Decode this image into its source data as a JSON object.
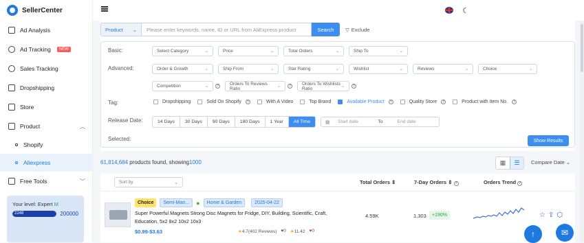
{
  "app": {
    "name": "SellerCenter"
  },
  "sidebar": {
    "items": [
      {
        "label": "Ad Analysis",
        "icon": "chart-icon"
      },
      {
        "label": "Ad Tracking",
        "icon": "target-icon",
        "badge": "NEW"
      },
      {
        "label": "Sales Tracking",
        "icon": "gauge-icon"
      },
      {
        "label": "Dropshipping",
        "icon": "box-icon"
      },
      {
        "label": "Store",
        "icon": "store-icon"
      },
      {
        "label": "Product",
        "icon": "product-icon"
      },
      {
        "label": "Free Tools",
        "icon": "tools-icon"
      }
    ],
    "sub_items": [
      {
        "label": "Shopify"
      },
      {
        "label": "Aliexpress",
        "active": true
      }
    ],
    "level": {
      "label": "Your level: Expert ",
      "tier": "M",
      "current": "2248",
      "max": "200000",
      "progress_fraction": 0.011
    }
  },
  "search": {
    "scope": "Product",
    "placeholder": "Please enter keywords,  name, ID or URL from AliExpress product",
    "button": "Search",
    "exclude": "Exclude"
  },
  "filters": {
    "basic_label": "Basic:",
    "basic": [
      "Select Category",
      "Price",
      "Total Orders",
      "Ship To"
    ],
    "advanced_label": "Advanced:",
    "advanced_row1": [
      "Order & Growth",
      "Ship From",
      "Star Rating",
      "Wishlist",
      "Reviews",
      "Choice"
    ],
    "advanced_row2": [
      "Competition",
      "Orders To Reviews Ratio",
      "Orders To Wishlists Ratio"
    ],
    "tag_label": "Tag:",
    "tags": [
      {
        "label": "Dropshipping",
        "checked": false
      },
      {
        "label": "Sold On Shopify",
        "checked": false,
        "help": true
      },
      {
        "label": "With A Video",
        "checked": false
      },
      {
        "label": "Top Brand",
        "checked": false
      },
      {
        "label": "Available Product",
        "checked": true,
        "help": true
      },
      {
        "label": "Quality Store",
        "checked": false,
        "help": true
      },
      {
        "label": "Product with Item No.",
        "checked": false,
        "help": true
      }
    ],
    "release_label": "Release Date:",
    "release_options": [
      "14 Days",
      "30 Days",
      "90 Days",
      "180 Days",
      "1 Year",
      "All Time"
    ],
    "release_selected": "All Time",
    "start_placeholder": "Start date",
    "to": "To",
    "end_placeholder": "End date",
    "selected_label": "Selected:",
    "show_results": "Show Results"
  },
  "results": {
    "count": "61,814,684",
    "text": " products found, showing",
    "showing": "1000",
    "compare": "Compare Date"
  },
  "table": {
    "sort_placeholder": "Sort by",
    "headers": {
      "total_orders": "Total Orders",
      "seven_day": "7-Day Orders",
      "trend": "Orders Trend"
    },
    "rows": [
      {
        "tags": [
          "Choice",
          "Semi-Man...",
          "Home & Garden",
          "2025-04-22"
        ],
        "title": "Super Powerful Magnets Strong Disc Magnets for Fridge, DIY, Building, Scientific, Craft, Education, 5x2 8x2 10x2 10x3",
        "price": "$0.99-$3.63",
        "rating": "4.7(402 Reviews)",
        "hearts": "0",
        "store_rating": "11.42",
        "likes": "0",
        "total_orders": "4.59K",
        "seven_day": "1,303",
        "growth": "+190%"
      }
    ]
  }
}
